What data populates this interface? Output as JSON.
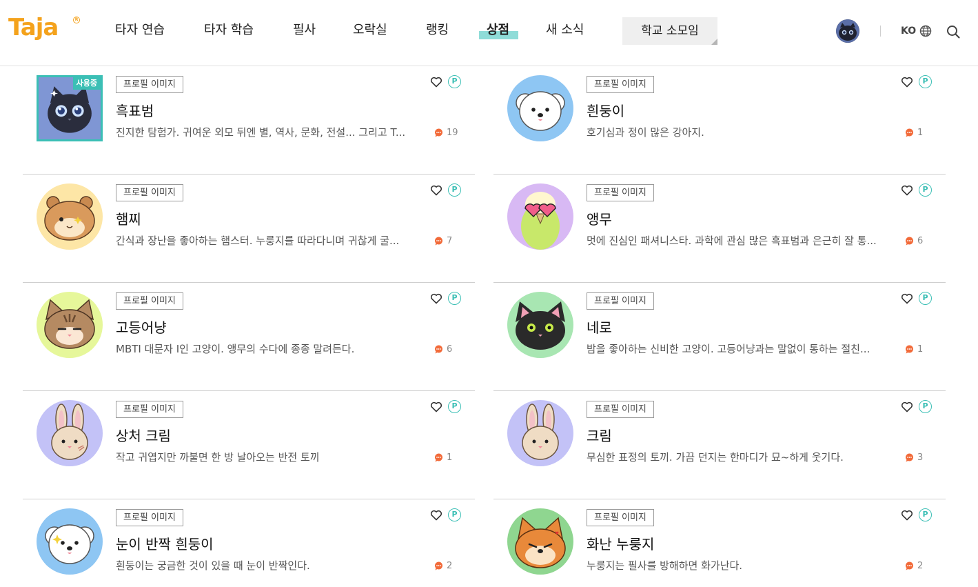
{
  "header": {
    "logo": "Taja",
    "nav": [
      "타자 연습",
      "타자 학습",
      "필사",
      "오락실",
      "랭킹",
      "상점",
      "새 소식"
    ],
    "active_nav": "상점",
    "club_button": "학교 소모임",
    "language": "KO"
  },
  "colors": {
    "accent": "#3bbfb5",
    "logo": "#f4a21c",
    "comment": "#f26b3a",
    "nav_highlight": "#8fdcd8"
  },
  "items": [
    {
      "tag": "프로필 이미지",
      "name": "흑표범",
      "desc": "진지한 탐험가. 귀여운 외모 뒤엔 별, 역사, 문화, 전설... 그리고 T...",
      "comments": "19",
      "in_use": "사용중",
      "avatar": "panther",
      "bg": "#7f96d4"
    },
    {
      "tag": "프로필 이미지",
      "name": "흰둥이",
      "desc": "호기심과 정이 많은 강아지.",
      "comments": "1",
      "avatar": "white-dog",
      "bg": "#8ec6f3"
    },
    {
      "tag": "프로필 이미지",
      "name": "햄찌",
      "desc": "간식과 장난을 좋아하는 햄스터. 누룽지를 따라다니며 귀찮게 굴...",
      "comments": "7",
      "avatar": "hamster",
      "bg": "#fde6a6"
    },
    {
      "tag": "프로필 이미지",
      "name": "앵무",
      "desc": "멋에 진심인 패셔니스타. 과학에 관심 많은 흑표범과 은근히 잘 통...",
      "comments": "6",
      "avatar": "parrot",
      "bg": "#d8b9f4"
    },
    {
      "tag": "프로필 이미지",
      "name": "고등어냥",
      "desc": "MBTI 대문자 I인 고양이. 앵무의 수다에 종종 말려든다.",
      "comments": "6",
      "avatar": "tabby-cat",
      "bg": "#e6f79a"
    },
    {
      "tag": "프로필 이미지",
      "name": "네로",
      "desc": "밤을 좋아하는 신비한 고양이. 고등어냥과는 말없이 통하는 절친...",
      "comments": "1",
      "avatar": "black-cat",
      "bg": "#a8e6b2"
    },
    {
      "tag": "프로필 이미지",
      "name": "상처 크림",
      "desc": "작고 귀엽지만 까불면 한 방 날아오는 반전 토끼",
      "comments": "1",
      "avatar": "bunny-scar",
      "bg": "#c3c2f7"
    },
    {
      "tag": "프로필 이미지",
      "name": "크림",
      "desc": "무심한 표정의 토끼. 가끔 던지는 한마디가 묘~하게 웃기다.",
      "comments": "3",
      "avatar": "bunny",
      "bg": "#c3c2f7"
    },
    {
      "tag": "프로필 이미지",
      "name": "눈이 반짝 흰둥이",
      "desc": "흰둥이는 궁금한 것이 있을 때 눈이 반짝인다.",
      "comments": "2",
      "avatar": "white-dog-sparkle",
      "bg": "#8ec6f3"
    },
    {
      "tag": "프로필 이미지",
      "name": "화난 누룽지",
      "desc": "누룽지는 필사를 방해하면 화가난다.",
      "comments": "2",
      "avatar": "angry-shiba",
      "bg": "#8fd690"
    }
  ]
}
